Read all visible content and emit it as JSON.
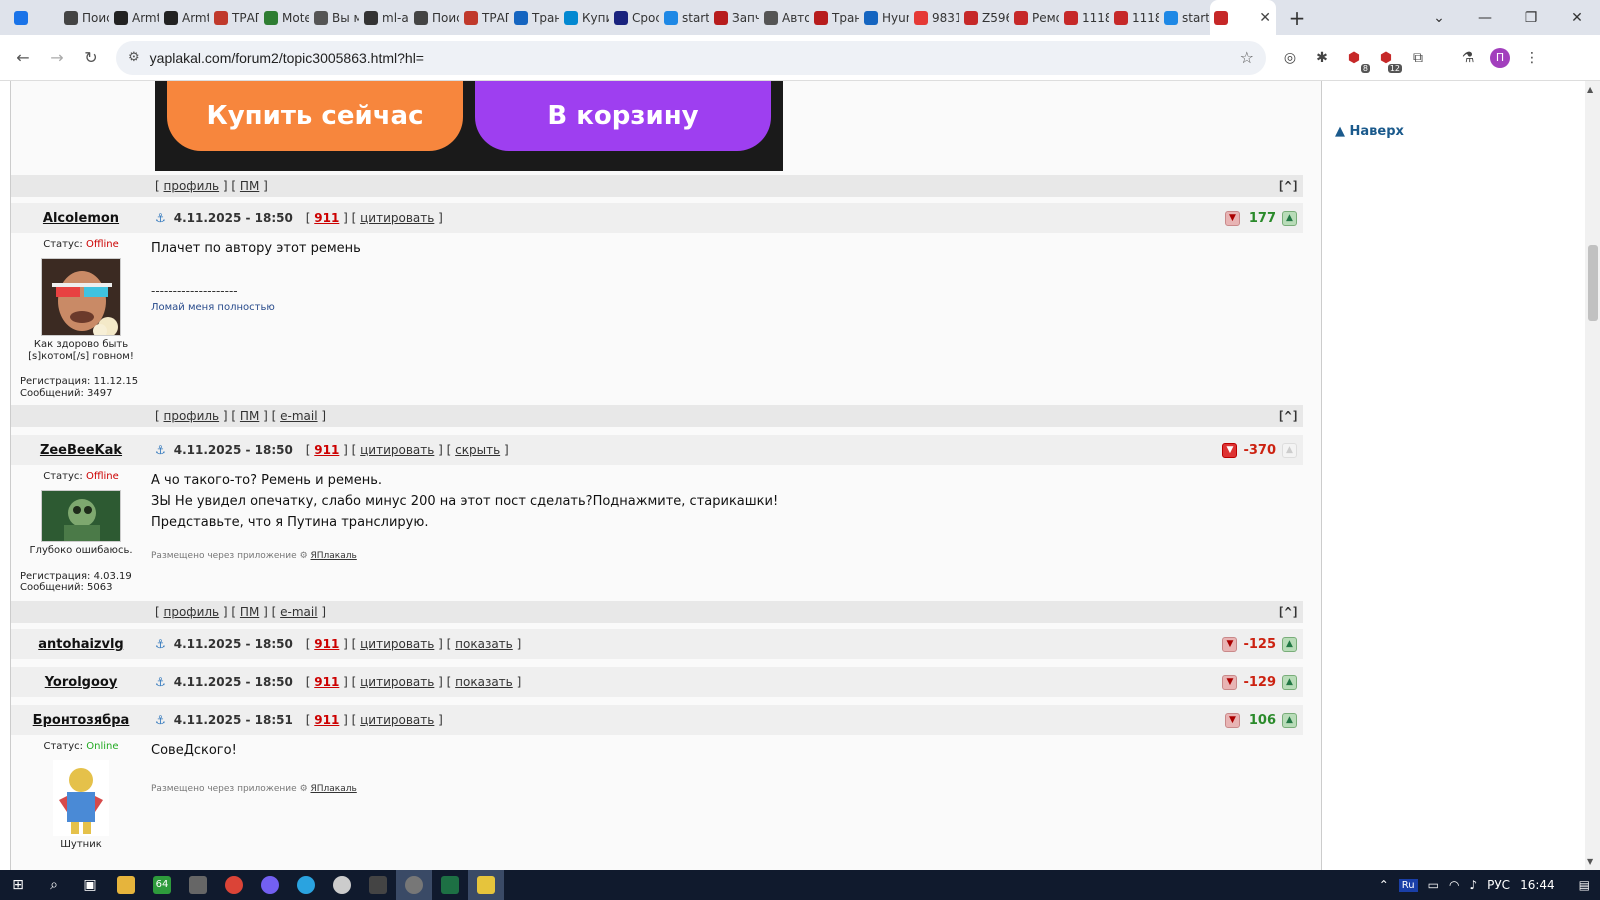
{
  "browser": {
    "tabs": [
      {
        "label": "",
        "color": "#1a73e8"
      },
      {
        "label": "Поис",
        "color": "#444444"
      },
      {
        "label": "Armt",
        "color": "#222222"
      },
      {
        "label": "Armt",
        "color": "#222222"
      },
      {
        "label": "ТРАП",
        "color": "#c0392b"
      },
      {
        "label": "Mote",
        "color": "#2e7d32"
      },
      {
        "label": "Вы м",
        "color": "#555555"
      },
      {
        "label": "ml-au",
        "color": "#333333"
      },
      {
        "label": "Поис",
        "color": "#444444"
      },
      {
        "label": "ТРАП",
        "color": "#c0392b"
      },
      {
        "label": "Тран",
        "color": "#1565c0"
      },
      {
        "label": "Купи",
        "color": "#0288d1"
      },
      {
        "label": "Срос",
        "color": "#1a237e"
      },
      {
        "label": "start.",
        "color": "#1e88e5"
      },
      {
        "label": "Запч",
        "color": "#b71c1c"
      },
      {
        "label": "Авто",
        "color": "#555555"
      },
      {
        "label": "Тран",
        "color": "#b71c1c"
      },
      {
        "label": "Hyun",
        "color": "#1565c0"
      },
      {
        "label": "98310",
        "color": "#e53935"
      },
      {
        "label": "Z596",
        "color": "#c62828"
      },
      {
        "label": "Ремо",
        "color": "#c62828"
      },
      {
        "label": "1118",
        "color": "#c62828"
      },
      {
        "label": "1118",
        "color": "#c62828"
      },
      {
        "label": "start.",
        "color": "#1e88e5"
      }
    ],
    "active_tab_close": "✕",
    "new_tab": "+",
    "url": "yaplakal.com/forum2/topic3005863.html?hl=",
    "ext_badge_1": "8",
    "ext_badge_2": "12",
    "profile_initial": "П"
  },
  "ad": {
    "buy_label": "Купить сейчас",
    "cart_label": "В корзину"
  },
  "sidebar": {
    "to_top": "Наверх"
  },
  "footer_links": {
    "profile": "профиль",
    "pm": "ПМ",
    "email": "e-mail",
    "up": "[^]"
  },
  "posts": [
    {
      "nick": "Alcolemon",
      "date": "4.11.2025 - 18:50",
      "num": "911",
      "quote": "цитировать",
      "extra": "",
      "score": "177",
      "status_label": "Статус:",
      "status": "Offline",
      "tagline": "Как здорово быть [s]котом[/s] говном!",
      "reg": "Регистрация: 11.12.15",
      "msgs": "Сообщений: 3497",
      "lines": [
        "Плачет по автору этот ремень"
      ],
      "sig_sep": "--------------------",
      "sig": "Ломай меня полностью",
      "via": ""
    },
    {
      "nick": "ZeeBeeKak",
      "date": "4.11.2025 - 18:50",
      "num": "911",
      "quote": "цитировать",
      "extra": "скрыть",
      "score": "-370",
      "status_label": "Статус:",
      "status": "Offline",
      "tagline": "Глубоко ошибаюсь.",
      "reg": "Регистрация: 4.03.19",
      "msgs": "Сообщений: 5063",
      "lines": [
        "А чо такого-то? Ремень и ремень.",
        "ЗЫ Не увидел опечатку, слабо минус 200 на этот пост сделать?Поднажмите, старикашки!",
        "Представьте, что я Путина транслирую."
      ],
      "via_text": "Размещено через приложение",
      "via_link": "ЯПлакаль"
    },
    {
      "nick": "antohaizvlg",
      "date": "4.11.2025 - 18:50",
      "num": "911",
      "quote": "цитировать",
      "extra": "показать",
      "score": "-125"
    },
    {
      "nick": "Yorolgooy",
      "date": "4.11.2025 - 18:50",
      "num": "911",
      "quote": "цитировать",
      "extra": "показать",
      "score": "-129"
    },
    {
      "nick": "Бронтозябра",
      "date": "4.11.2025 - 18:51",
      "num": "911",
      "quote": "цитировать",
      "extra": "",
      "score": "106",
      "status_label": "Статус:",
      "status": "Online",
      "tagline": "Шутник",
      "lines": [
        "СовеДского!"
      ],
      "via_text": "Размещено через приложение",
      "via_link": "ЯПлакаль"
    }
  ],
  "taskbar": {
    "lang": "РУС",
    "time": "16:44",
    "ru": "Ru",
    "app_64": "64"
  }
}
